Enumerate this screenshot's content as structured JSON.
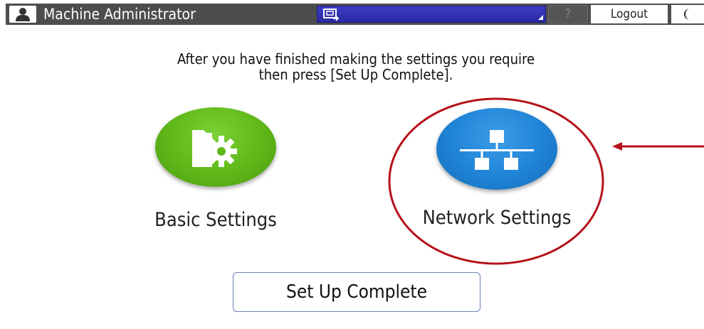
{
  "header": {
    "user_icon": "user-icon",
    "user_label": "Machine Administrator",
    "status_icon": "screen-status-icon",
    "help_label": "?",
    "logout_label": "Logout",
    "night_icon": "moon-icon"
  },
  "main": {
    "instruction_line1": "After you have finished making the settings you require",
    "instruction_line2": "then press [Set Up Complete].",
    "basic_settings": {
      "label": "Basic Settings",
      "icon": "folder-gear-icon",
      "color": "#5fb718"
    },
    "network_settings": {
      "label": "Network Settings",
      "icon": "network-icon",
      "color": "#1f83d6"
    },
    "set_up_complete_label": "Set Up Complete"
  },
  "annotations": {
    "highlight_color": "#b5121b",
    "highlight": "red-circle-highlight",
    "arrow": "red-arrow"
  }
}
